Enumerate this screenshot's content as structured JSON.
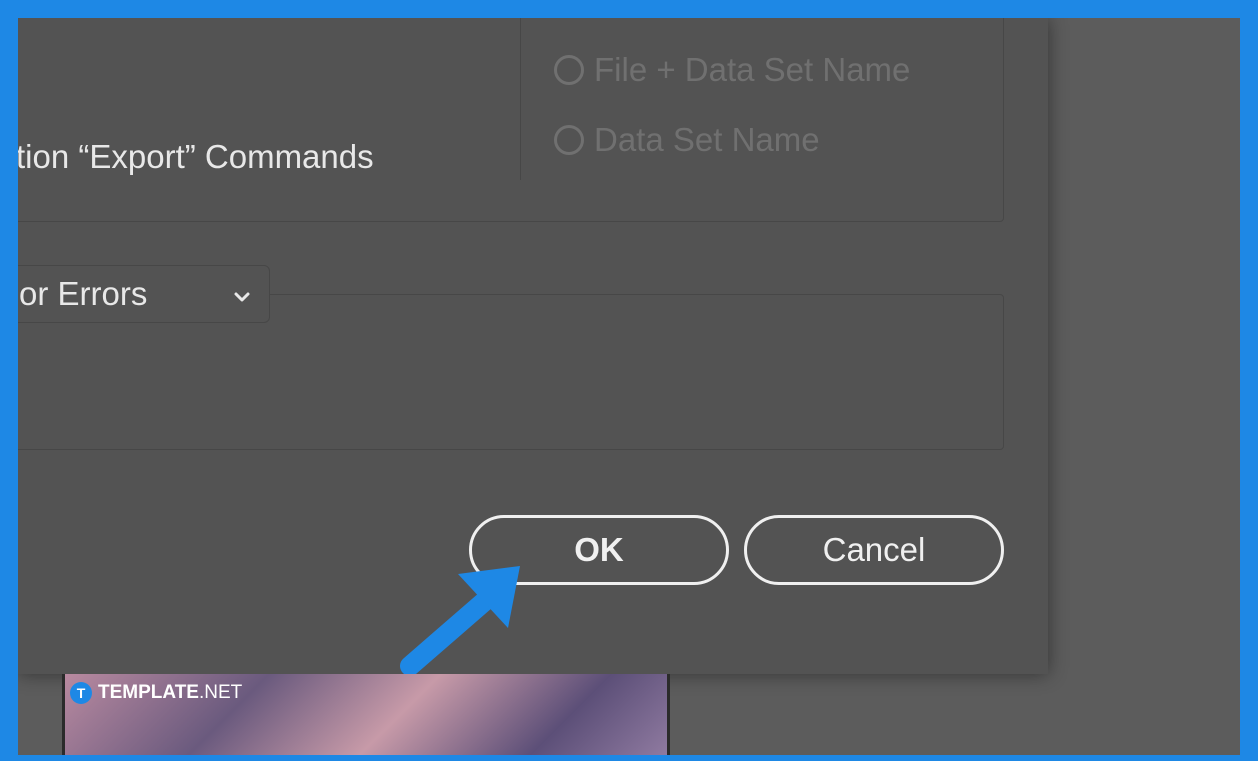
{
  "dialog": {
    "options_radio": [
      {
        "label": "File + Data Set Name",
        "selected": false
      },
      {
        "label": "Data Set Name",
        "selected": false
      }
    ],
    "commands_label": "tion “Export” Commands",
    "error_select": {
      "value": "or Errors"
    },
    "buttons": {
      "ok": "OK",
      "cancel": "Cancel"
    }
  },
  "watermark": {
    "brand": "TEMPLATE",
    "suffix": ".NET",
    "logo_letter": "T"
  },
  "colors": {
    "frame_border": "#1e88e5",
    "dialog_bg": "#535353",
    "arrow": "#1e88e5"
  },
  "icons": {
    "select": "chevron-down-icon",
    "pointer": "arrow-pointer-icon"
  }
}
